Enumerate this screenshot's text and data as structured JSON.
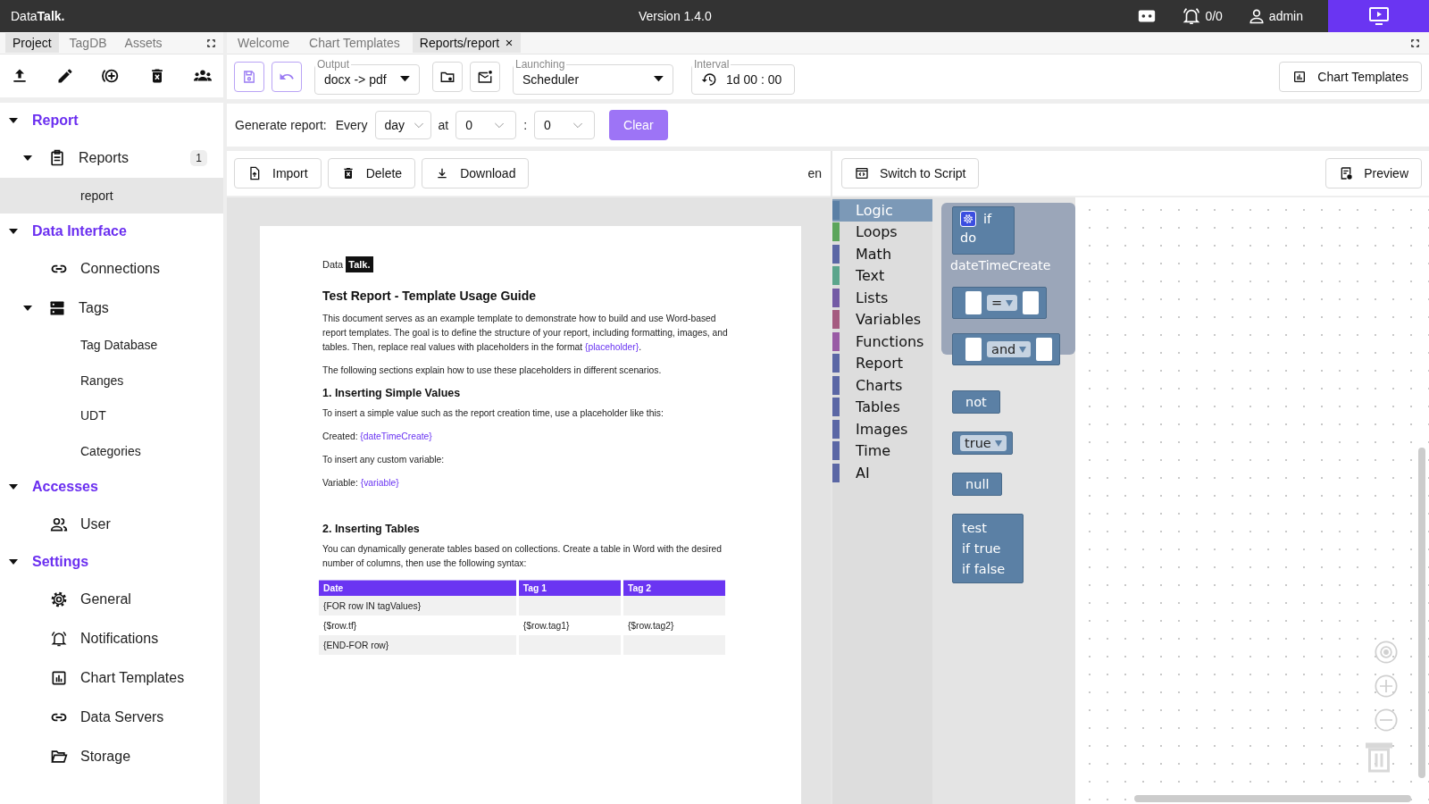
{
  "topbar": {
    "logo": "Data**Talk.**",
    "version": "Version 1.4.0",
    "alarm_count": "0/0",
    "user": "admin"
  },
  "sidebar": {
    "tabs": [
      {
        "label": "Project",
        "selected": true
      },
      {
        "label": "TagDB",
        "selected": false
      },
      {
        "label": "Assets",
        "selected": false
      }
    ],
    "tree": [
      {
        "label": "Report",
        "selected": false,
        "expanded": true,
        "children": [
          {
            "label": "Reports",
            "badge": "1",
            "selected": false,
            "expanded": true,
            "children": [
              {
                "label": "report",
                "selected": true
              }
            ]
          }
        ]
      },
      {
        "label": "Data Interface",
        "selected": false,
        "expanded": true,
        "children": [
          {
            "label": "Connections",
            "selected": false
          },
          {
            "label": "Tags",
            "selected": false,
            "expanded": true,
            "children": [
              {
                "label": "Tag Database",
                "selected": false
              },
              {
                "label": "Ranges",
                "selected": false
              },
              {
                "label": "UDT",
                "selected": false
              },
              {
                "label": "Categories",
                "selected": false
              }
            ]
          }
        ]
      },
      {
        "label": "Accesses",
        "selected": false,
        "expanded": true,
        "children": [
          {
            "label": "User",
            "selected": false
          }
        ]
      },
      {
        "label": "Settings",
        "selected": false,
        "expanded": true,
        "children": [
          {
            "label": "General",
            "selected": false
          },
          {
            "label": "Notifications",
            "selected": false
          },
          {
            "label": "Chart Templates",
            "selected": false
          },
          {
            "label": "Data Servers",
            "selected": false
          },
          {
            "label": "Storage",
            "selected": false
          }
        ]
      }
    ]
  },
  "tabs": [
    {
      "label": "Welcome",
      "selected": false,
      "closable": false
    },
    {
      "label": "Chart Templates",
      "selected": false,
      "closable": false
    },
    {
      "label": "Reports/report",
      "selected": true,
      "closable": true
    }
  ],
  "toolbar": {
    "output": {
      "label": "Output",
      "value": "docx -> pdf"
    },
    "launching": {
      "label": "Launching",
      "value": "Scheduler"
    },
    "interval": {
      "label": "Interval",
      "value": "1d 00 : 00"
    },
    "chart_templates_button": "Chart Templates"
  },
  "schedule": {
    "label": "Generate report:",
    "every_label": "Every",
    "period": "day",
    "at_label": "at",
    "hour": "0",
    "separator": ":",
    "minute": "0",
    "clear_button": "Clear"
  },
  "document_toolbar": {
    "buttons": [
      "Import",
      "Delete",
      "Download"
    ],
    "language": "en"
  },
  "document": {
    "logo_text": "Data",
    "logo_mark": "Talk.",
    "title": "Test Report - Template Usage Guide",
    "blocks": [
      {
        "kind": "paragraph",
        "segments": [
          {
            "kind": "plain",
            "text": "This document serves as an example template to demonstrate how to build and use Word-based report templates. The goal is to define the structure of your report, including formatting, images, and tables. Then, replace real values with placeholders in the format "
          },
          {
            "kind": "placeholder",
            "text": "{placeholder}"
          },
          {
            "kind": "plain",
            "text": "."
          }
        ]
      },
      {
        "kind": "paragraph",
        "segments": [
          {
            "kind": "plain",
            "text": "The following sections explain how to use these placeholders in different scenarios."
          }
        ]
      },
      {
        "kind": "heading",
        "segments": [
          {
            "kind": "plain",
            "text": "1. Inserting Simple Values"
          }
        ]
      },
      {
        "kind": "paragraph",
        "segments": [
          {
            "kind": "plain",
            "text": "To insert a simple value such as the report creation time, use a placeholder like this:"
          }
        ]
      },
      {
        "kind": "paragraph",
        "segments": [
          {
            "kind": "plain",
            "text": "Created: "
          },
          {
            "kind": "placeholder",
            "text": "{dateTimeCreate}"
          }
        ]
      },
      {
        "kind": "paragraph",
        "segments": [
          {
            "kind": "plain",
            "text": "To insert any custom variable:"
          }
        ]
      },
      {
        "kind": "paragraph",
        "segments": [
          {
            "kind": "plain",
            "text": "Variable: "
          },
          {
            "kind": "placeholder",
            "text": "{variable}"
          }
        ]
      },
      {
        "kind": "heading",
        "segments": [
          {
            "kind": "plain",
            "text": "2. Inserting Tables"
          }
        ]
      },
      {
        "kind": "paragraph",
        "segments": [
          {
            "kind": "plain",
            "text": "You can dynamically generate tables based on collections. Create a table in Word with the desired number of columns, then use the following syntax:"
          }
        ]
      }
    ],
    "table": {
      "columns": [
        "Date",
        "Tag 1",
        "Tag 2"
      ],
      "rows": [
        [
          "{FOR row IN tagValues}",
          "",
          ""
        ],
        [
          "{$row.tf}",
          "{$row.tag1}",
          "{$row.tag2}"
        ],
        [
          "{END-FOR row}",
          "",
          ""
        ]
      ]
    }
  },
  "editor": {
    "switch_button": "Switch to Script",
    "preview_button": "Preview",
    "toolbox": [
      {
        "label": "Logic",
        "color": "#5b80a5",
        "selected": true
      },
      {
        "label": "Loops",
        "color": "#5ba55b",
        "selected": false
      },
      {
        "label": "Math",
        "color": "#5b67a5",
        "selected": false
      },
      {
        "label": "Text",
        "color": "#5ba58c",
        "selected": false
      },
      {
        "label": "Lists",
        "color": "#745ba5",
        "selected": false
      },
      {
        "label": "Variables",
        "color": "#a55b80",
        "selected": false
      },
      {
        "label": "Functions",
        "color": "#995ba5",
        "selected": false
      },
      {
        "label": "Report",
        "color": "#5b67a5",
        "selected": false
      },
      {
        "label": "Charts",
        "color": "#5b67a5",
        "selected": false
      },
      {
        "label": "Tables",
        "color": "#5b67a5",
        "selected": false
      },
      {
        "label": "Images",
        "color": "#5b67a5",
        "selected": false
      },
      {
        "label": "Time",
        "color": "#5b67a5",
        "selected": false
      },
      {
        "label": "AI",
        "color": "#5b67a5",
        "selected": false
      }
    ],
    "workspace_label": "dateTimeCreate",
    "blocks": [
      {
        "kind": "if",
        "labels": [
          "if",
          "do"
        ]
      },
      {
        "kind": "compare",
        "op": "="
      },
      {
        "kind": "operation",
        "op": "and"
      },
      {
        "kind": "negate",
        "labels": [
          "not"
        ]
      },
      {
        "kind": "boolean",
        "op": "true"
      },
      {
        "kind": "null",
        "labels": [
          "null"
        ]
      },
      {
        "kind": "ternary",
        "labels": [
          "test",
          "if true",
          "if false"
        ]
      }
    ]
  }
}
